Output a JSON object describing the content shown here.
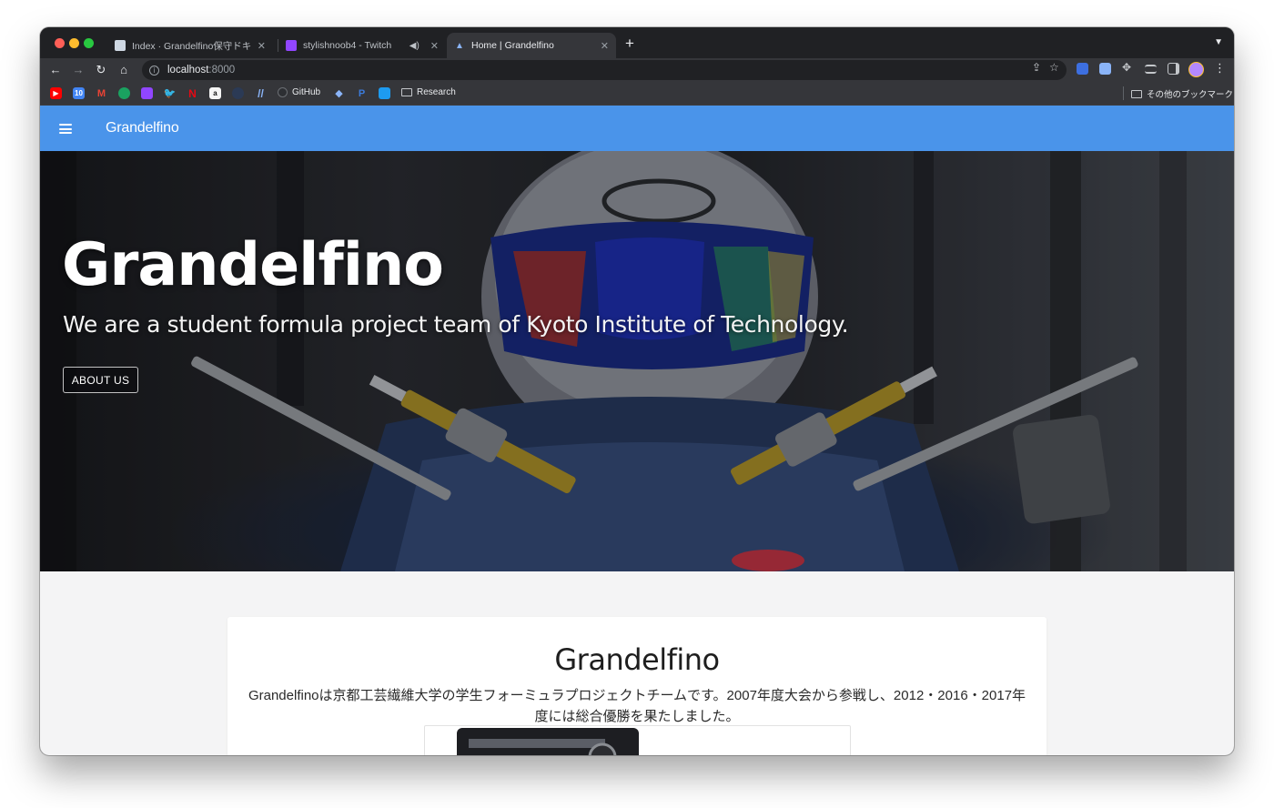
{
  "browser": {
    "tabs": [
      {
        "title": "Index · Grandelfino保守ドキュメ",
        "favicon": "book-icon",
        "active": false
      },
      {
        "title": "stylishnoob4 - Twitch",
        "favicon": "twitch-icon",
        "active": false,
        "audio": true
      },
      {
        "title": "Home | Grandelfino",
        "favicon": "triangle-icon",
        "active": true
      }
    ],
    "url": {
      "host": "localhost",
      "port": ":8000"
    },
    "bookmarks": [
      {
        "label": "GitHub",
        "icon": "github-icon"
      },
      {
        "label": "Research",
        "icon": "folder-icon"
      }
    ],
    "other_bookmarks": "その他のブックマーク"
  },
  "appbar": {
    "brand": "Grandelfino",
    "color": "#4a94ea"
  },
  "hero": {
    "title": "Grandelfino",
    "subtitle": "We are a student formula project team of Kyoto Institute of Technology.",
    "button_label": "ABOUT US"
  },
  "intro": {
    "title": "Grandelfino",
    "body": "Grandelfinoは京都工芸繊維大学の学生フォーミュラプロジェクトチームです。2007年度大会から参戦し、2012・2016・2017年度には総合優勝を果たしました。"
  }
}
